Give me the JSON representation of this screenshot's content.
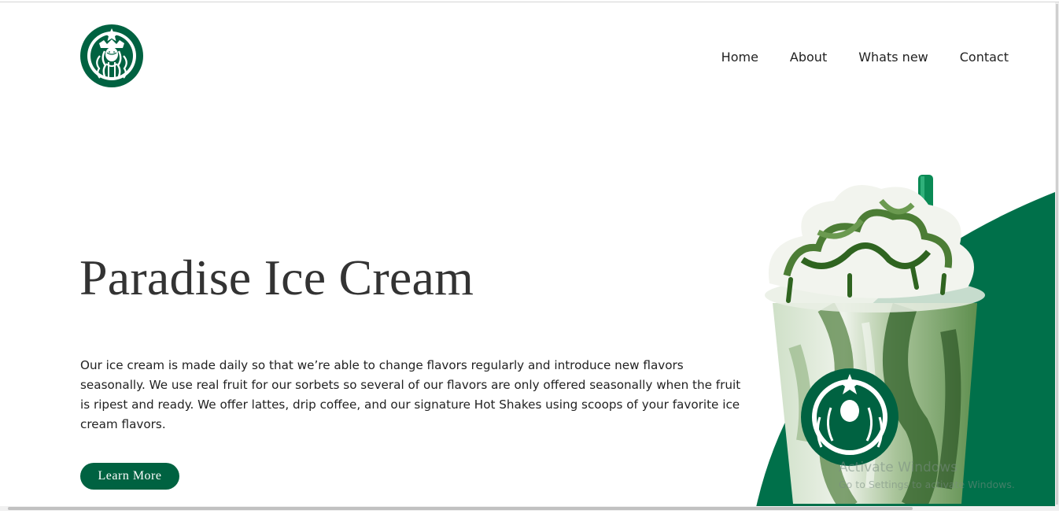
{
  "brand": {
    "logo_icon": "starbucks-siren-logo-icon",
    "color": "#006241"
  },
  "nav": {
    "items": [
      "Home",
      "About",
      "Whats new",
      "Contact"
    ]
  },
  "hero": {
    "title": "Paradise Ice Cream",
    "description": "Our ice cream is made daily so that we’re able to change flavors regularly and introduce new flavors seasonally. We use real fruit for our sorbets so several of our flavors are only offered seasonally when the fruit is ripest and ready. We offer lattes, drip coffee, and our signature Hot Shakes using scoops of your favorite ice cream flavors.",
    "button_label": "Learn More",
    "image_icon": "matcha-frappuccino-image-icon"
  },
  "watermark": {
    "title": "Activate Windows",
    "subtitle": "Go to Settings to activate Windows."
  }
}
